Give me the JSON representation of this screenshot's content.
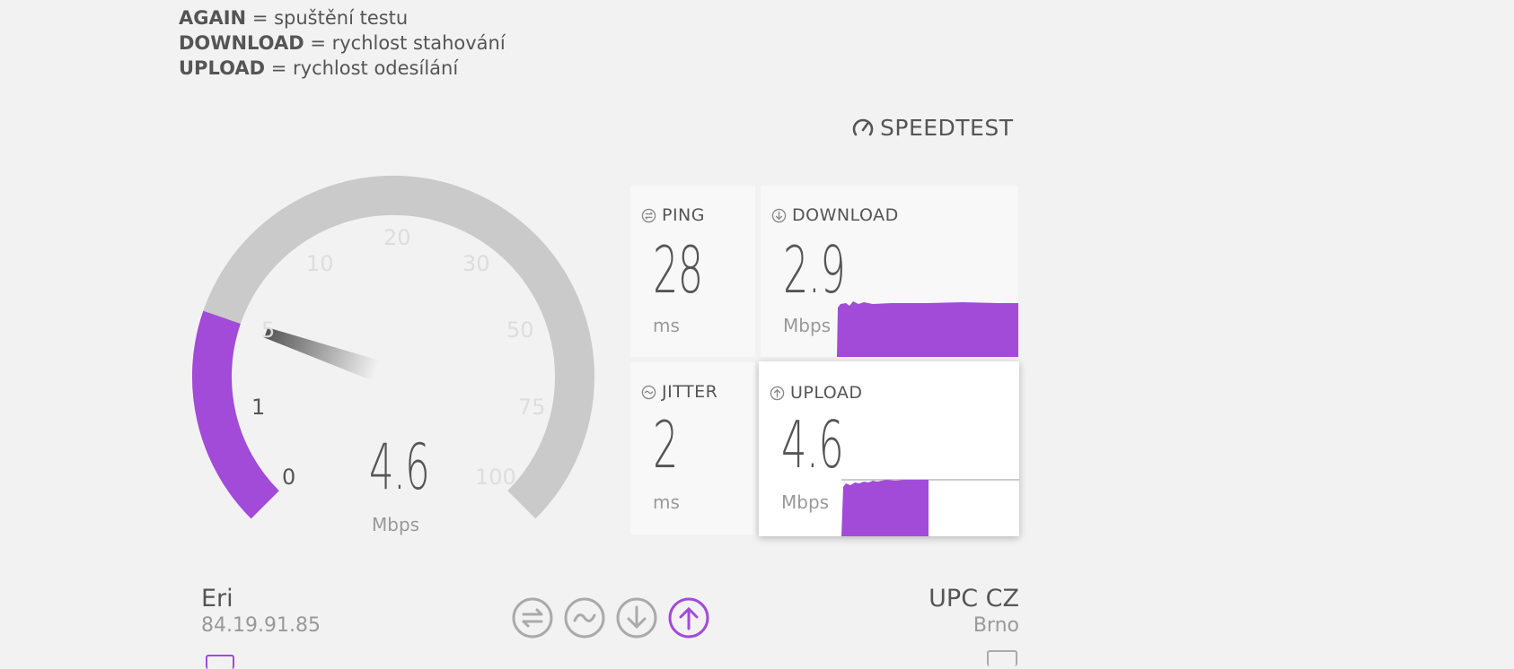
{
  "legend": [
    {
      "key": "AGAIN",
      "text": " = spuštění testu"
    },
    {
      "key": "DOWNLOAD",
      "text": " = rychlost stahování"
    },
    {
      "key": "UPLOAD",
      "text": " = rychlost odesílání"
    }
  ],
  "brand": {
    "name": "SPEEDTEST",
    "icon": "speedometer-icon"
  },
  "gauge": {
    "value": "4.6",
    "unit": "Mbps",
    "scale": [
      "0",
      "1",
      "5",
      "10",
      "20",
      "30",
      "50",
      "75",
      "100"
    ],
    "fill_value": 4.6,
    "accent": "#a14bd8"
  },
  "ping": {
    "label": "PING",
    "value": "28",
    "unit": "ms",
    "icon": "ping-icon"
  },
  "jitter": {
    "label": "JITTER",
    "value": "2",
    "unit": "ms",
    "icon": "jitter-icon"
  },
  "download": {
    "label": "DOWNLOAD",
    "value": "2.9",
    "unit": "Mbps",
    "icon": "download-arrow-icon"
  },
  "upload": {
    "label": "UPLOAD",
    "value": "4.6",
    "unit": "Mbps",
    "icon": "upload-arrow-icon"
  },
  "client": {
    "name": "Eri",
    "ip": "84.19.91.85"
  },
  "server": {
    "name": "UPC CZ",
    "location": "Brno"
  },
  "steps": [
    {
      "name": "ping-step-icon",
      "active": false
    },
    {
      "name": "jitter-step-icon",
      "active": false
    },
    {
      "name": "download-step-icon",
      "active": false
    },
    {
      "name": "upload-step-icon",
      "active": true
    }
  ],
  "colors": {
    "accent": "#a14bd8",
    "track": "#cacaca",
    "text": "#555555",
    "muted": "#999999"
  }
}
